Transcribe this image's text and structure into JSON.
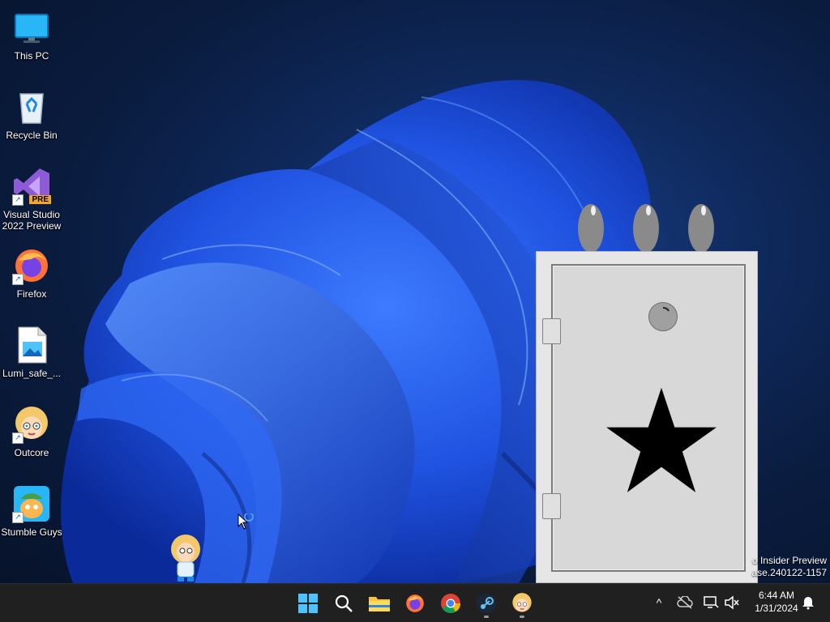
{
  "desktop": {
    "icons": [
      {
        "label": "This PC",
        "icon": "monitor-icon",
        "shortcut": false
      },
      {
        "label": "Recycle Bin",
        "icon": "recycle-bin-icon",
        "shortcut": false
      },
      {
        "label": "Visual Studio 2022 Preview",
        "icon": "visual-studio-icon",
        "badge": "PRE",
        "shortcut": true
      },
      {
        "label": "Firefox",
        "icon": "firefox-icon",
        "shortcut": true
      },
      {
        "label": "Lumi_safe_...",
        "icon": "image-file-icon",
        "shortcut": false
      },
      {
        "label": "Outcore",
        "icon": "outcore-icon",
        "shortcut": true
      },
      {
        "label": "Stumble Guys",
        "icon": "stumble-guys-icon",
        "shortcut": true
      }
    ],
    "watermark": {
      "line1": "o Insider Preview",
      "line2": "ase.240122-1157"
    }
  },
  "safe_window": {
    "title": "",
    "colors": {
      "body": "#e6e6e6",
      "door": "#d8d8d8",
      "star": "#000000",
      "egg": "#8a8a8a"
    }
  },
  "taskbar": {
    "apps": [
      {
        "name": "start-button",
        "icon": "windows-logo-icon"
      },
      {
        "name": "search-button",
        "icon": "search-icon"
      },
      {
        "name": "file-explorer-button",
        "icon": "folder-icon"
      },
      {
        "name": "firefox-taskbar-button",
        "icon": "firefox-icon"
      },
      {
        "name": "chrome-taskbar-button",
        "icon": "chrome-icon"
      },
      {
        "name": "steam-taskbar-button",
        "icon": "steam-icon"
      },
      {
        "name": "outcore-taskbar-button",
        "icon": "outcore-icon"
      }
    ],
    "tray": {
      "chevron": "^",
      "time": "6:44 AM",
      "date": "1/31/2024"
    }
  }
}
